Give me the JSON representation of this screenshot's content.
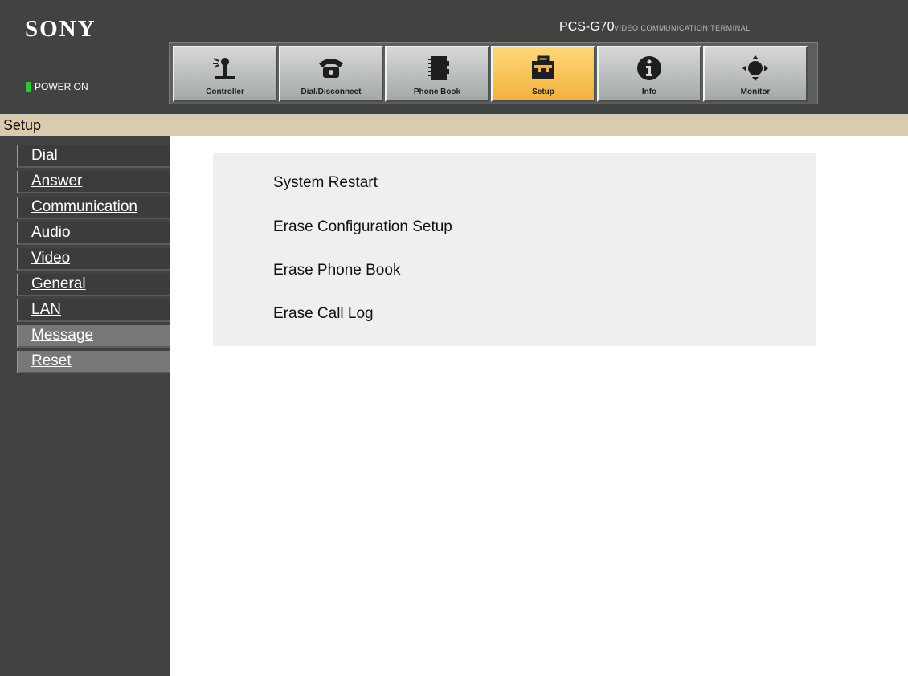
{
  "header": {
    "logo": "SONY",
    "model": "PCS-G70",
    "subtitle": "VIDEO COMMUNICATION TERMINAL",
    "power_status": "POWER ON",
    "power_color": "#2ec435"
  },
  "toolbar": {
    "buttons": [
      {
        "label": "Controller",
        "icon": "controller-icon"
      },
      {
        "label": "Dial/Disconnect",
        "icon": "telephone-icon"
      },
      {
        "label": "Phone Book",
        "icon": "phone-book-icon"
      },
      {
        "label": "Setup",
        "icon": "toolbox-icon",
        "active": true
      },
      {
        "label": "Info",
        "icon": "info-icon"
      },
      {
        "label": "Monitor",
        "icon": "direction-pad-icon"
      }
    ],
    "active_color": "#f3b13d"
  },
  "section": {
    "title": "Setup"
  },
  "sidebar": {
    "items": [
      {
        "label": "Dial"
      },
      {
        "label": "Answer"
      },
      {
        "label": "Communication"
      },
      {
        "label": "Audio"
      },
      {
        "label": "Video"
      },
      {
        "label": "General"
      },
      {
        "label": "LAN"
      },
      {
        "label": "Message"
      },
      {
        "label": "Reset"
      }
    ]
  },
  "main": {
    "options": [
      {
        "label": "System Restart"
      },
      {
        "label": "Erase Configuration Setup"
      },
      {
        "label": "Erase Phone Book"
      },
      {
        "label": "Erase Call Log"
      }
    ]
  }
}
